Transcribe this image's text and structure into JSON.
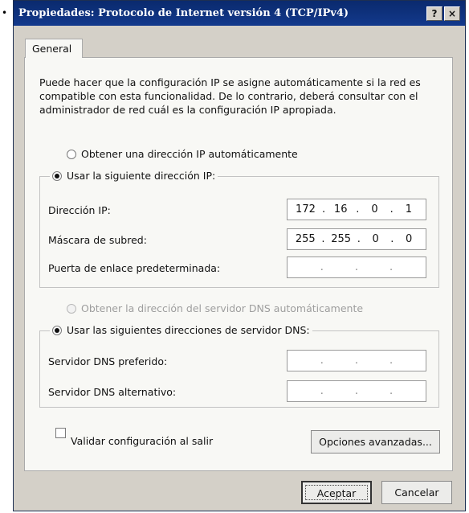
{
  "window": {
    "title": "Propiedades: Protocolo de Internet versión 4 (TCP/IPv4)",
    "help_label": "?",
    "close_label": "×"
  },
  "tab": {
    "label": "General"
  },
  "description": "Puede hacer que la configuración IP se asigne automáticamente si la red es compatible con esta funcionalidad. De lo contrario, deberá consultar con el administrador de red cuál es la configuración IP apropiada.",
  "ip_section": {
    "auto_label": "Obtener una dirección IP automáticamente",
    "manual_label": "Usar la siguiente dirección IP:",
    "selected": "manual",
    "fields": [
      {
        "label": "Dirección IP:",
        "octets": [
          "172",
          "16",
          "0",
          "1"
        ]
      },
      {
        "label": "Máscara de subred:",
        "octets": [
          "255",
          "255",
          "0",
          "0"
        ]
      },
      {
        "label": "Puerta de enlace predeterminada:",
        "octets": [
          "",
          "",
          "",
          ""
        ]
      }
    ]
  },
  "dns_section": {
    "auto_label": "Obtener la dirección del servidor DNS automáticamente",
    "auto_disabled": true,
    "manual_label": "Usar las siguientes direcciones de servidor DNS:",
    "selected": "manual",
    "fields": [
      {
        "label": "Servidor DNS preferido:",
        "octets": [
          "",
          "",
          "",
          ""
        ]
      },
      {
        "label": "Servidor DNS alternativo:",
        "octets": [
          "",
          "",
          "",
          ""
        ]
      }
    ]
  },
  "validate": {
    "label": "Validar configuración al salir",
    "checked": false
  },
  "buttons": {
    "advanced": "Opciones avanzadas...",
    "ok": "Aceptar",
    "cancel": "Cancelar"
  }
}
